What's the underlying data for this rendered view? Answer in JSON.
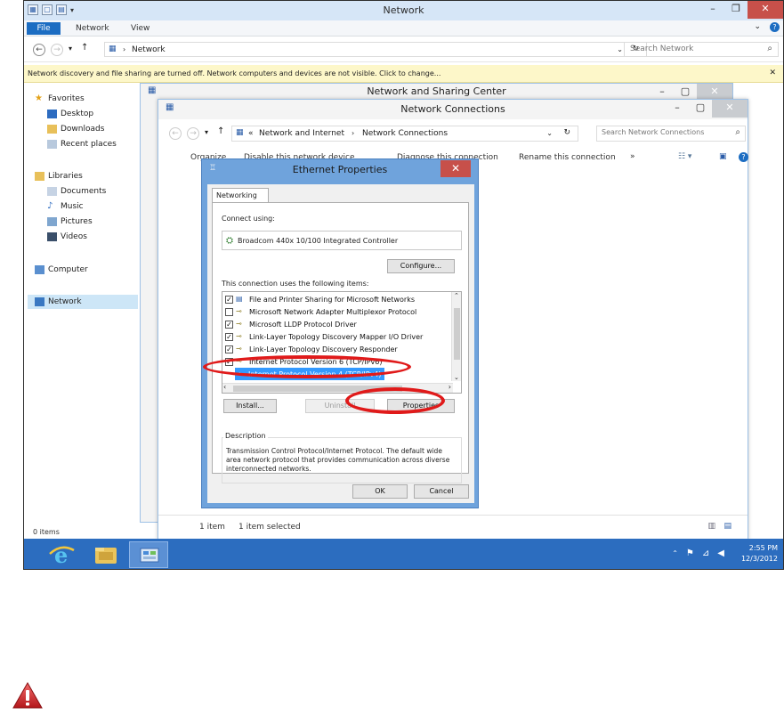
{
  "explorer": {
    "title": "Network",
    "ribbon_tabs": [
      "File",
      "Network",
      "View"
    ],
    "address": "Network",
    "search_placeholder": "Search Network",
    "infobar": "Network discovery and file sharing are turned off. Network computers and devices are not visible. Click to change...",
    "nav": {
      "favorites": "Favorites",
      "desktop": "Desktop",
      "downloads": "Downloads",
      "recent": "Recent places",
      "libraries": "Libraries",
      "documents": "Documents",
      "music": "Music",
      "pictures": "Pictures",
      "videos": "Videos",
      "computer": "Computer",
      "network": "Network"
    },
    "status_items": "0 items"
  },
  "nsc": {
    "title": "Network and Sharing Center"
  },
  "nc": {
    "title": "Network Connections",
    "breadcrumb_1": "Network and Internet",
    "breadcrumb_2": "Network Connections",
    "search_placeholder": "Search Network Connections",
    "toolbar": {
      "organize": "Organize",
      "disable": "Disable this network device",
      "diagnose": "Diagnose this connection",
      "rename": "Rename this connection",
      "more": "»"
    },
    "status_count": "1 item",
    "status_selected": "1 item selected"
  },
  "dialog": {
    "title": "Ethernet Properties",
    "tab": "Networking",
    "connect_using": "Connect using:",
    "adapter": "Broadcom 440x 10/100 Integrated Controller",
    "configure": "Configure...",
    "items_label": "This connection uses the following items:",
    "items": [
      {
        "label": "File and Printer Sharing for Microsoft Networks",
        "checked": true
      },
      {
        "label": "Microsoft Network Adapter Multiplexor Protocol",
        "checked": false
      },
      {
        "label": "Microsoft LLDP Protocol Driver",
        "checked": true
      },
      {
        "label": "Link-Layer Topology Discovery Mapper I/O Driver",
        "checked": true
      },
      {
        "label": "Link-Layer Topology Discovery Responder",
        "checked": true
      },
      {
        "label": "Internet Protocol Version 6 (TCP/IPv6)",
        "checked": true
      },
      {
        "label": "Internet Protocol Version 4 (TCP/IPv4)",
        "checked": true,
        "selected": true
      }
    ],
    "install": "Install...",
    "uninstall": "Uninstall",
    "properties": "Properties",
    "description_label": "Description",
    "description": "Transmission Control Protocol/Internet Protocol. The default wide area network protocol that provides communication across diverse interconnected networks.",
    "ok": "OK",
    "cancel": "Cancel"
  },
  "taskbar": {
    "time": "2:55 PM",
    "date": "12/3/2012"
  },
  "colors": {
    "taskbar": "#2c6dbf",
    "dialog_frame": "#6fa3dc",
    "close_button": "#c7504a",
    "selection": "#3399ff",
    "annotation": "#e01a1a",
    "infobar": "#fdf7c9"
  },
  "icons": [
    "ie-icon",
    "file-explorer-icon",
    "control-panel-icon",
    "warning-icon",
    "network-adapter-icon",
    "search-icon",
    "help-icon",
    "refresh-icon",
    "flag-icon",
    "network-tray-icon",
    "volume-icon"
  ]
}
